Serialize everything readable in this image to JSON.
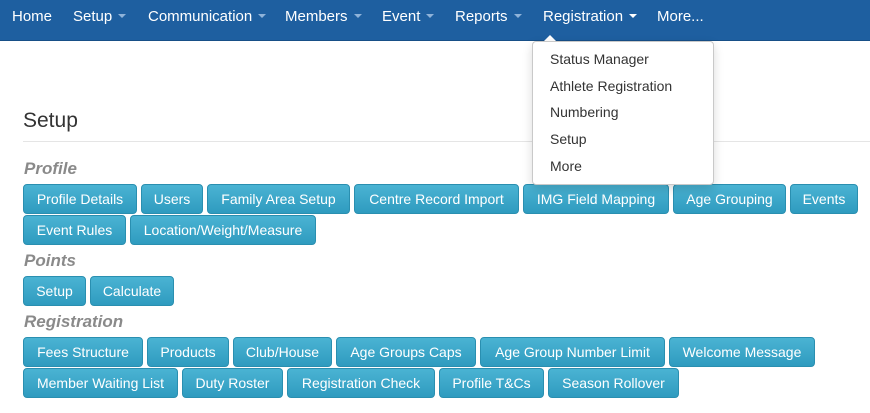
{
  "nav": {
    "items": [
      {
        "label": "Home",
        "caret": false
      },
      {
        "label": "Setup",
        "caret": true
      },
      {
        "label": "Communication",
        "caret": true
      },
      {
        "label": "Members",
        "caret": true
      },
      {
        "label": "Event",
        "caret": true
      },
      {
        "label": "Reports",
        "caret": true
      },
      {
        "label": "Registration",
        "caret": true,
        "active": true
      },
      {
        "label": "More...",
        "caret": false
      }
    ]
  },
  "registration_menu": {
    "items": [
      "Status Manager",
      "Athlete Registration",
      "Numbering",
      "Setup",
      "More"
    ]
  },
  "page": {
    "title": "Setup"
  },
  "sections": {
    "profile": {
      "label": "Profile",
      "buttons": [
        "Profile Details",
        "Users",
        "Family Area Setup",
        "Centre Record Import",
        "IMG Field Mapping",
        "Age Grouping",
        "Events",
        "Event Rules",
        "Location/Weight/Measure"
      ]
    },
    "points": {
      "label": "Points",
      "buttons": [
        "Setup",
        "Calculate"
      ]
    },
    "registration": {
      "label": "Registration",
      "buttons": [
        "Fees Structure",
        "Products",
        "Club/House",
        "Age Groups Caps",
        "Age Group Number Limit",
        "Welcome Message",
        "Member Waiting List",
        "Duty Roster",
        "Registration Check",
        "Profile T&Cs",
        "Season Rollover"
      ]
    }
  },
  "colors": {
    "navbar": "#1e5fa0",
    "button": "#3aa6c9",
    "section_label": "#8a8a8a"
  }
}
